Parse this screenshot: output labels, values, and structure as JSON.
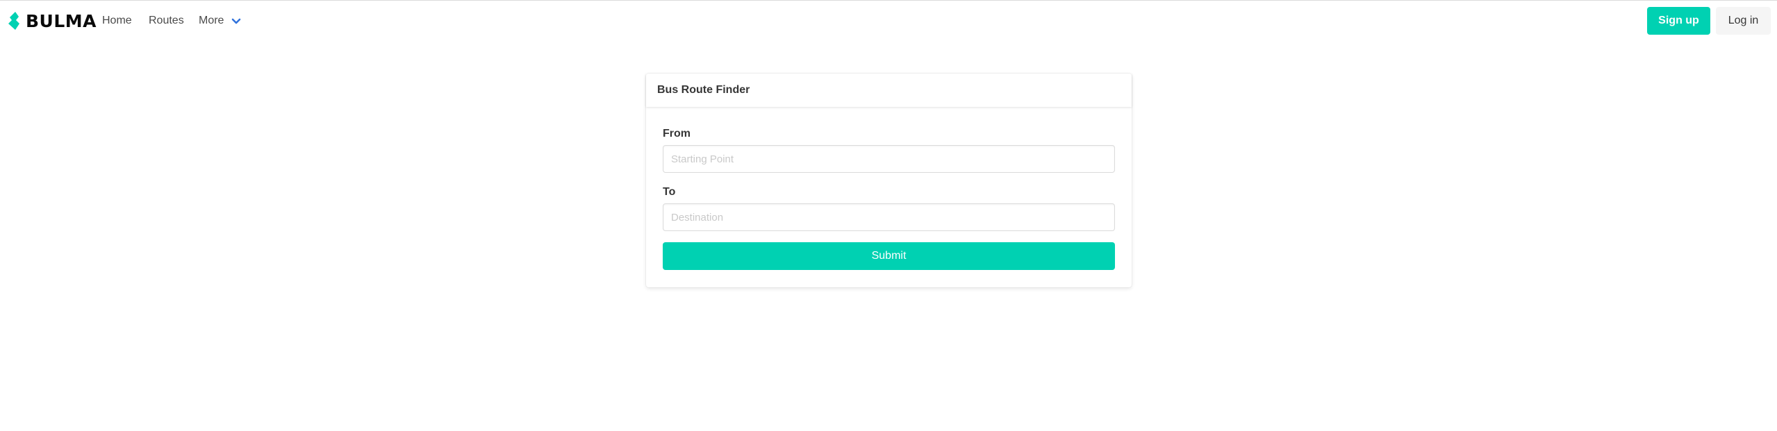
{
  "navbar": {
    "brand": "BULMA",
    "brand_icon": "bulma-logo-icon",
    "items": [
      {
        "label": "Home"
      },
      {
        "label": "Routes"
      },
      {
        "label": "More",
        "icon": "chevron-down-icon"
      }
    ],
    "signup_label": "Sign up",
    "login_label": "Log in"
  },
  "card": {
    "title": "Bus Route Finder",
    "from_label": "From",
    "from_placeholder": "Starting Point",
    "from_value": "",
    "to_label": "To",
    "to_placeholder": "Destination",
    "to_value": "",
    "submit_label": "Submit"
  },
  "colors": {
    "primary": "#00d1b2",
    "dropdown_arrow": "#3273dc",
    "text": "#4a4a4a",
    "light_button": "#f5f5f5"
  }
}
